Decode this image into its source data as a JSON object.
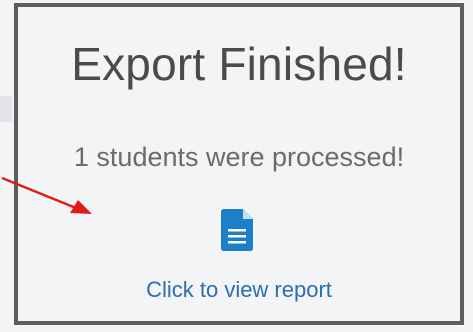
{
  "dialog": {
    "title": "Export Finished!",
    "message": "1 students were processed!",
    "link_label": "Click to view report"
  },
  "icons": {
    "report": "document-icon",
    "annotation": "red-arrow-icon"
  },
  "colors": {
    "link": "#2a6db3",
    "icon": "#1e7fc9",
    "arrow": "#e11b1b",
    "border": "#5e5e5e"
  }
}
